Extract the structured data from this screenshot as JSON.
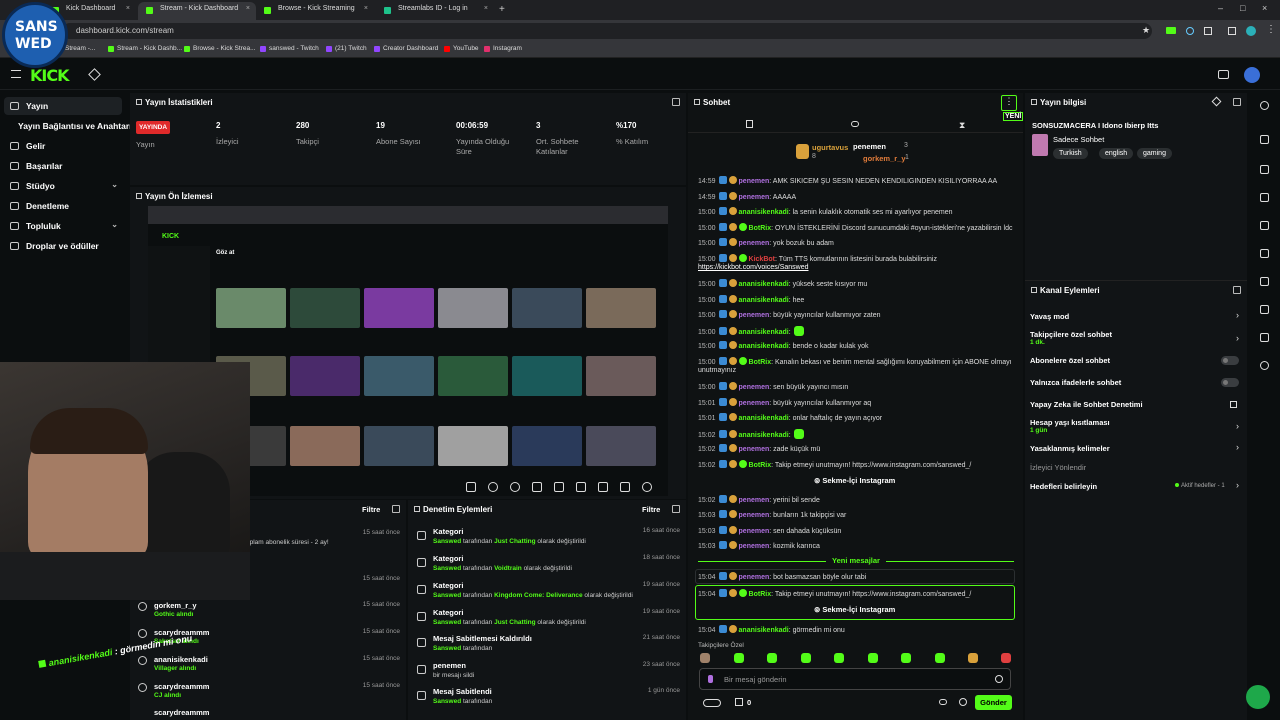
{
  "browser": {
    "tabs": [
      "Kick Dashboard",
      "Stream - Kick Dashboard",
      "Browse - Kick Streaming",
      "Streamlabs ID - Log in"
    ],
    "url": "dashboard.kick.com/stream",
    "bookmarks": [
      "Stream -...",
      "Stream - Kick Dashb...",
      "Browse - Kick Strea...",
      "sanswed - Twitch",
      "(21) Twitch",
      "Creator Dashboard",
      "YouTube",
      "Instagram"
    ]
  },
  "overlay": {
    "logo_lines": [
      "SANS",
      "WED"
    ],
    "chat_overlay_user": "ananisikenkadi",
    "chat_overlay_text": " : görmedin mi onu"
  },
  "header": {
    "logo": "KICK"
  },
  "sidebar": {
    "items": [
      {
        "label": "Yayın"
      },
      {
        "label": "Yayın Bağlantısı ve Anahtarı"
      },
      {
        "label": "Gelir"
      },
      {
        "label": "Başarılar"
      },
      {
        "label": "Stüdyo"
      },
      {
        "label": "Denetleme"
      },
      {
        "label": "Topluluk"
      },
      {
        "label": "Droplar ve ödüller"
      }
    ]
  },
  "stats": {
    "title": "Yayın İstatistikleri",
    "live_badge": "YAYINDA",
    "items": [
      {
        "value": "",
        "label": "Yayın"
      },
      {
        "value": "2",
        "label": "İzleyici"
      },
      {
        "value": "280",
        "label": "Takipçi"
      },
      {
        "value": "19",
        "label": "Abone Sayısı"
      },
      {
        "value": "00:06:59",
        "label": "Yayında Olduğu Süre"
      },
      {
        "value": "3",
        "label": "Ort. Sohbete Katılanlar"
      },
      {
        "value": "%170",
        "label": "% Katılım"
      }
    ]
  },
  "preview": {
    "title": "Yayın Ön İzlemesi",
    "inner_heading": "Göz at"
  },
  "activity": {
    "filter": "Filtre",
    "fragment": "oplam abonelik süresi - 2 ay!",
    "items": [
      {
        "user": "",
        "action": "",
        "time": "15 saat önce"
      },
      {
        "user": "",
        "action": "",
        "time": "15 saat önce"
      },
      {
        "user": "gorkem_r_y",
        "action": "Gothic alındı",
        "time": "15 saat önce"
      },
      {
        "user": "scarydreammm",
        "action": "Sakatsız alındı",
        "time": "15 saat önce"
      },
      {
        "user": "ananisikenkadi",
        "action": "Villager alındı",
        "time": "15 saat önce"
      },
      {
        "user": "scarydreammm",
        "action": "CJ alındı",
        "time": "15 saat önce"
      },
      {
        "user": "scarydreammm",
        "action": "",
        "time": ""
      }
    ]
  },
  "moderation": {
    "title": "Denetim Eylemleri",
    "filter": "Filtre",
    "items": [
      {
        "name": "Kategori",
        "by": "Sanswed",
        "mid": " tarafından ",
        "hl": "Just Chatting",
        "end": " olarak değiştirildi",
        "time": "16 saat önce"
      },
      {
        "name": "Kategori",
        "by": "Sanswed",
        "mid": " tarafından ",
        "hl": "Voidtrain",
        "end": " olarak değiştirildi",
        "time": "18 saat önce"
      },
      {
        "name": "Kategori",
        "by": "Sanswed",
        "mid": " tarafından ",
        "hl": "Kingdom Come: Deliverance",
        "end": " olarak değiştirildi",
        "time": "19 saat önce"
      },
      {
        "name": "Kategori",
        "by": "Sanswed",
        "mid": " tarafından ",
        "hl": "Just Chatting",
        "end": " olarak değiştirildi",
        "time": "19 saat önce"
      },
      {
        "name": "Mesaj Sabitlemesi Kaldırıldı",
        "by": "Sanswed",
        "mid": " tarafından",
        "hl": "",
        "end": "",
        "time": "21 saat önce"
      },
      {
        "name": "penemen",
        "by": "",
        "mid": "bir mesajı sildi",
        "hl": "",
        "end": "",
        "time": "23 saat önce"
      },
      {
        "name": "Mesaj Sabitlendi",
        "by": "Sanswed",
        "mid": " tarafından",
        "hl": "",
        "end": "",
        "time": "1 gün önce"
      }
    ]
  },
  "chat": {
    "title": "Sohbet",
    "new_label": "YENİ",
    "leaderboard": [
      {
        "name": "ugurtavus",
        "count": "8"
      },
      {
        "name": "penemen",
        "count": "3"
      },
      {
        "name": "gorkem_r_y",
        "count": "1"
      }
    ],
    "messages": [
      {
        "t": "14:59",
        "u": "penemen",
        "c": "#b070e0",
        "m": ": AMK SIKICEM ŞU SESIN NEDEN KENDILIGINDEN KISILIYORRAA AA"
      },
      {
        "t": "14:59",
        "u": "penemen",
        "c": "#b070e0",
        "m": ": AAAAA"
      },
      {
        "t": "15:00",
        "u": "ananisikenkadi",
        "c": "#53fc18",
        "m": ": la senin kulaklık otomatik ses mi ayarlıyor penemen"
      },
      {
        "t": "15:00",
        "u": "BotRix",
        "c": "#53fc18",
        "m": ": OYUN İSTEKLERİNİ Discord sunucumdaki #oyun-istekleri'ne yazabilirsin ldc"
      },
      {
        "t": "15:00",
        "u": "penemen",
        "c": "#b070e0",
        "m": ": yok bozuk bu adam"
      },
      {
        "t": "15:00",
        "u": "KickBot",
        "c": "#e04040",
        "m": ": Tüm TTS komutlarının listesini burada bulabilirsiniz"
      },
      {
        "t": "",
        "u": "",
        "c": "#fff",
        "m": "https://kickbot.com/voices/Sanswed"
      },
      {
        "t": "15:00",
        "u": "ananisikenkadi",
        "c": "#53fc18",
        "m": ": yüksek seste kısıyor mu"
      },
      {
        "t": "15:00",
        "u": "ananisikenkadi",
        "c": "#53fc18",
        "m": ": hee"
      },
      {
        "t": "15:00",
        "u": "penemen",
        "c": "#b070e0",
        "m": ": büyük yayıncılar kullanmıyor zaten"
      },
      {
        "t": "15:00",
        "u": "ananisikenkadi",
        "c": "#53fc18",
        "m": ":"
      },
      {
        "t": "15:00",
        "u": "ananisikenkadi",
        "c": "#53fc18",
        "m": ": bende o kadar kulak yok"
      },
      {
        "t": "15:00",
        "u": "BotRix",
        "c": "#53fc18",
        "m": ": Kanalın bekası ve benim mental sağlığımı koruyabilmem için ABONE olmayı"
      },
      {
        "t": "",
        "u": "",
        "c": "#ddd",
        "m": "unutmayınız"
      },
      {
        "t": "15:00",
        "u": "penemen",
        "c": "#b070e0",
        "m": ": sen büyük yayıncı mısın"
      },
      {
        "t": "15:01",
        "u": "penemen",
        "c": "#b070e0",
        "m": ": büyük yayıncılar kullanmıyor aq"
      },
      {
        "t": "15:01",
        "u": "ananisikenkadi",
        "c": "#53fc18",
        "m": ": onlar haftalıç de yayın açıyor"
      },
      {
        "t": "15:02",
        "u": "ananisikenkadi",
        "c": "#53fc18",
        "m": ":"
      },
      {
        "t": "15:02",
        "u": "penemen",
        "c": "#b070e0",
        "m": ": zade küçük mü"
      },
      {
        "t": "15:02",
        "u": "BotRix",
        "c": "#53fc18",
        "m": ": Takip etmeyi unutmayın! https://www.instagram.com/sanswed_/"
      }
    ],
    "sekme_label": "Sekme-İçi Instagram",
    "messages2": [
      {
        "t": "15:02",
        "u": "penemen",
        "c": "#b070e0",
        "m": ": yerini bil sende"
      },
      {
        "t": "15:03",
        "u": "penemen",
        "c": "#b070e0",
        "m": ": bunların 1k takipçisi var"
      },
      {
        "t": "15:03",
        "u": "penemen",
        "c": "#b070e0",
        "m": ": sen dahada küçüksün"
      },
      {
        "t": "15:03",
        "u": "penemen",
        "c": "#b070e0",
        "m": ": kozmik karınca"
      }
    ],
    "new_messages": "Yeni mesajlar",
    "messages3": [
      {
        "t": "15:04",
        "u": "penemen",
        "c": "#b070e0",
        "m": ": bot basmazsan böyle olur tabi"
      },
      {
        "t": "15:04",
        "u": "BotRix",
        "c": "#53fc18",
        "m": ": Takip etmeyi unutmayın! https://www.instagram.com/sanswed_/"
      }
    ],
    "last_message": {
      "t": "15:04",
      "u": "ananisikenkadi",
      "c": "#53fc18",
      "m": ": görmedin mi onu"
    },
    "followers_label": "Takipçilere Özel",
    "input_placeholder": "Bir mesaj gönderin",
    "points": "0",
    "send": "Gönder"
  },
  "stream_info": {
    "title": "Yayın bilgisi",
    "stream_title": "SONSUZMACERA I Idono Ibierp Itts",
    "category": "Sadece Sohbet",
    "tags": [
      "Turkish",
      "english",
      "gaming"
    ]
  },
  "channel_actions": {
    "title": "Kanal Eylemleri",
    "items": [
      {
        "label": "Yavaş mod",
        "sub": ""
      },
      {
        "label": "Takipçilere özel sohbet",
        "sub": "1 dk."
      },
      {
        "label": "Abonelere özel sohbet",
        "sub": ""
      },
      {
        "label": "Yalnızca ifadelerle sohbet",
        "sub": ""
      },
      {
        "label": "Yapay Zeka ile Sohbet Denetimi",
        "sub": ""
      },
      {
        "label": "Hesap yaşı kısıtlaması",
        "sub": "1 gün"
      },
      {
        "label": "Yasaklanmış kelimeler",
        "sub": ""
      },
      {
        "label": "İzleyici Yönlendir",
        "sub": ""
      },
      {
        "label": "Hedefleri belirleyin",
        "sub": ""
      }
    ],
    "goals_status": "Aktif hedefler - 1"
  },
  "colors": {
    "accent": "#53fc18",
    "live": "#e02a2a",
    "background": "#0b0e0f"
  }
}
